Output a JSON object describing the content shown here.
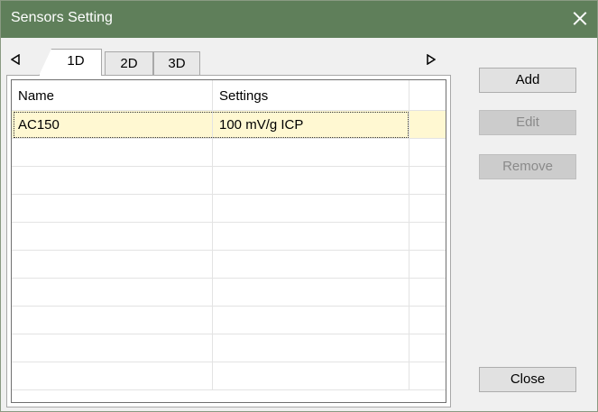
{
  "window": {
    "title": "Sensors Setting"
  },
  "tabs": [
    {
      "label": "1D",
      "active": true
    },
    {
      "label": "2D",
      "active": false
    },
    {
      "label": "3D",
      "active": false
    }
  ],
  "table": {
    "columns": [
      "Name",
      "Settings",
      ""
    ],
    "rows": [
      {
        "name": "AC150",
        "settings": "100 mV/g ICP",
        "selected": true
      }
    ],
    "empty_rows": 9
  },
  "buttons": {
    "add": {
      "label": "Add",
      "enabled": true
    },
    "edit": {
      "label": "Edit",
      "enabled": false
    },
    "remove": {
      "label": "Remove",
      "enabled": false
    },
    "close": {
      "label": "Close",
      "enabled": true
    }
  },
  "icons": {
    "close": "close-icon",
    "scroll_left": "triangle-left-icon",
    "scroll_right": "triangle-right-icon"
  },
  "colors": {
    "titlebar": "#5f7f5a",
    "selected_row": "#fff8d2",
    "disabled_button": "#cccccc"
  }
}
